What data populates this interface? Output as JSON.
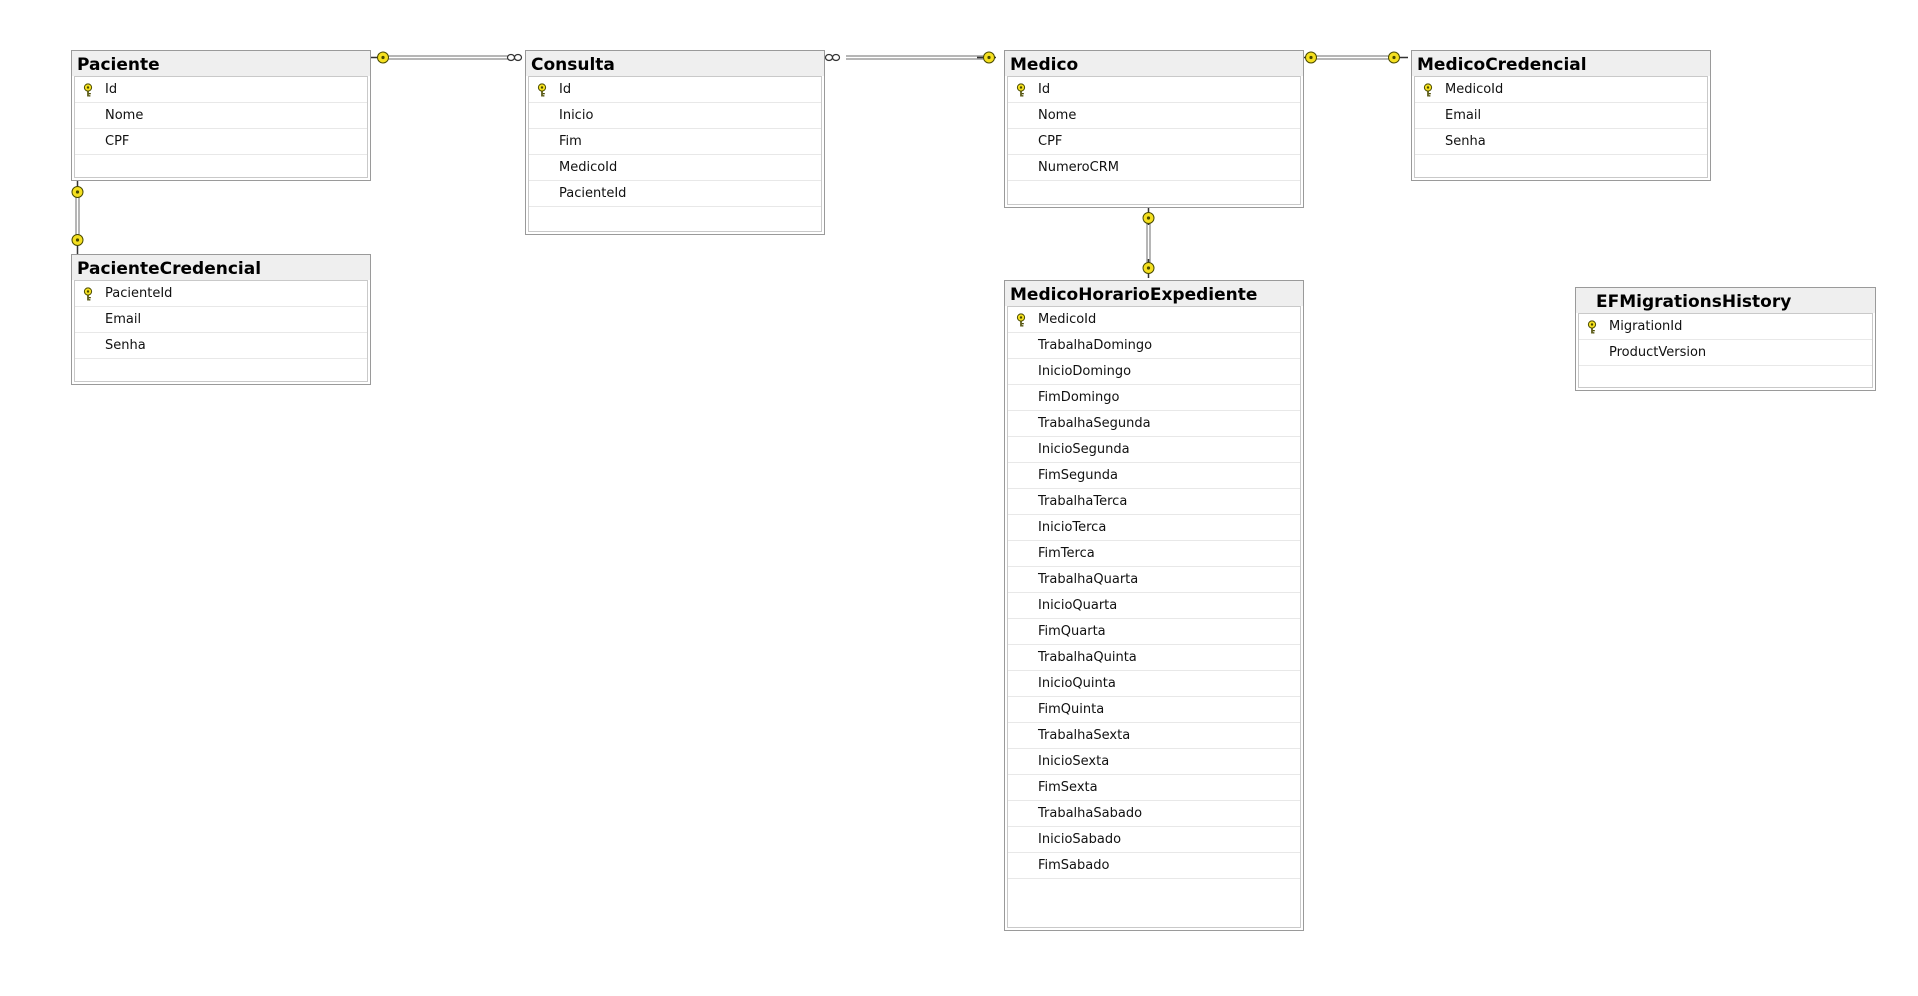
{
  "diagram": {
    "tables": [
      {
        "id": "paciente",
        "name": "Paciente",
        "columns": [
          {
            "name": "Id",
            "pk": true
          },
          {
            "name": "Nome",
            "pk": false
          },
          {
            "name": "CPF",
            "pk": false
          }
        ]
      },
      {
        "id": "consulta",
        "name": "Consulta",
        "columns": [
          {
            "name": "Id",
            "pk": true
          },
          {
            "name": "Inicio",
            "pk": false
          },
          {
            "name": "Fim",
            "pk": false
          },
          {
            "name": "MedicoId",
            "pk": false
          },
          {
            "name": "PacienteId",
            "pk": false
          }
        ]
      },
      {
        "id": "medico",
        "name": "Medico",
        "columns": [
          {
            "name": "Id",
            "pk": true
          },
          {
            "name": "Nome",
            "pk": false
          },
          {
            "name": "CPF",
            "pk": false
          },
          {
            "name": "NumeroCRM",
            "pk": false
          }
        ]
      },
      {
        "id": "medicocredencial",
        "name": "MedicoCredencial",
        "columns": [
          {
            "name": "MedicoId",
            "pk": true
          },
          {
            "name": "Email",
            "pk": false
          },
          {
            "name": "Senha",
            "pk": false
          }
        ]
      },
      {
        "id": "pacientecredencial",
        "name": "PacienteCredencial",
        "columns": [
          {
            "name": "PacienteId",
            "pk": true
          },
          {
            "name": "Email",
            "pk": false
          },
          {
            "name": "Senha",
            "pk": false
          }
        ]
      },
      {
        "id": "medicohorarioexpediente",
        "name": "MedicoHorarioExpediente",
        "columns": [
          {
            "name": "MedicoId",
            "pk": true
          },
          {
            "name": "TrabalhaDomingo",
            "pk": false
          },
          {
            "name": "InicioDomingo",
            "pk": false
          },
          {
            "name": "FimDomingo",
            "pk": false
          },
          {
            "name": "TrabalhaSegunda",
            "pk": false
          },
          {
            "name": "InicioSegunda",
            "pk": false
          },
          {
            "name": "FimSegunda",
            "pk": false
          },
          {
            "name": "TrabalhaTerca",
            "pk": false
          },
          {
            "name": "InicioTerca",
            "pk": false
          },
          {
            "name": "FimTerca",
            "pk": false
          },
          {
            "name": "TrabalhaQuarta",
            "pk": false
          },
          {
            "name": "InicioQuarta",
            "pk": false
          },
          {
            "name": "FimQuarta",
            "pk": false
          },
          {
            "name": "TrabalhaQuinta",
            "pk": false
          },
          {
            "name": "InicioQuinta",
            "pk": false
          },
          {
            "name": "FimQuinta",
            "pk": false
          },
          {
            "name": "TrabalhaSexta",
            "pk": false
          },
          {
            "name": "InicioSexta",
            "pk": false
          },
          {
            "name": "FimSexta",
            "pk": false
          },
          {
            "name": "TrabalhaSabado",
            "pk": false
          },
          {
            "name": "InicioSabado",
            "pk": false
          },
          {
            "name": "FimSabado",
            "pk": false
          }
        ]
      },
      {
        "id": "efmigrationshistory",
        "name": "EFMigrationsHistory",
        "columns": [
          {
            "name": "MigrationId",
            "pk": true
          },
          {
            "name": "ProductVersion",
            "pk": false
          }
        ]
      }
    ],
    "relationships": [
      {
        "from": "paciente",
        "to": "consulta",
        "from_end": "one",
        "to_end": "many"
      },
      {
        "from": "consulta",
        "to": "medico",
        "from_end": "many",
        "to_end": "one"
      },
      {
        "from": "medico",
        "to": "medicocredencial",
        "from_end": "one",
        "to_end": "one"
      },
      {
        "from": "paciente",
        "to": "pacientecredencial",
        "from_end": "one",
        "to_end": "one"
      },
      {
        "from": "medico",
        "to": "medicohorarioexpediente",
        "from_end": "one",
        "to_end": "one"
      }
    ],
    "colors": {
      "key": "#f5e020",
      "key_outline": "#4a4a00",
      "line": "#6e6e6e",
      "title_bg": "#efefef"
    }
  }
}
